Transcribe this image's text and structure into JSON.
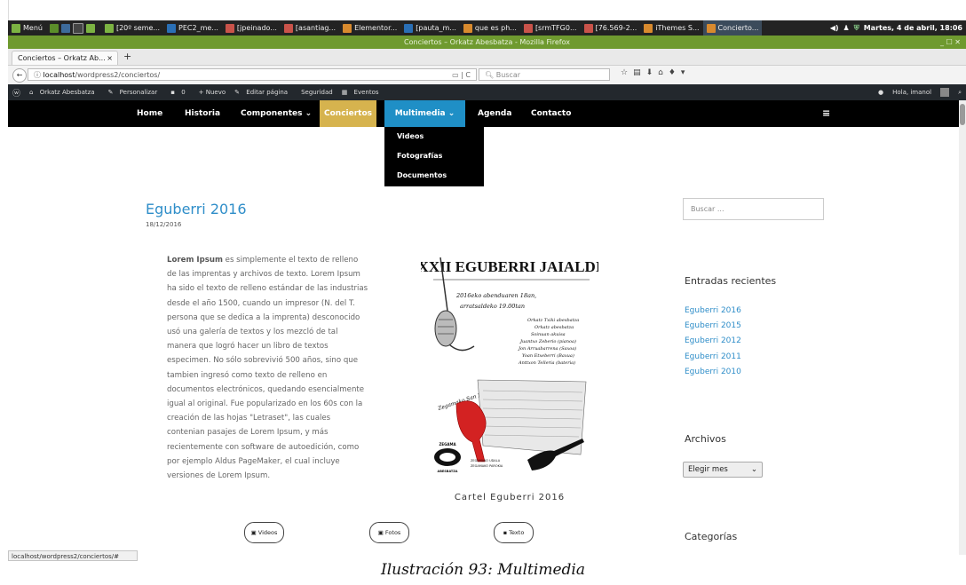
{
  "panel": {
    "menu_label": "Menú",
    "tasks": [
      "[20º seme...",
      "PEC2_me...",
      "[jpeinado...",
      "[asantiag...",
      "Elementor...",
      "[pauta_m...",
      "que es ph...",
      "[srmTFG0...",
      "[76.569-2...",
      "iThemes S...",
      "Concierto..."
    ],
    "clock": "Martes, 4 de abril, 18:06"
  },
  "window": {
    "title": "Conciertos – Orkatz Abesbatza - Mozilla Firefox",
    "tab_label": "Conciertos – Orkatz Ab...",
    "tab_close": "×",
    "new_tab": "+"
  },
  "navbar": {
    "back": "←",
    "url_host": "localhost",
    "url_path": "/wordpress2/conciertos/",
    "search_placeholder": "Buscar"
  },
  "admin_bar": {
    "site": "Orkatz Abesbatza",
    "customize": "Personalizar",
    "comments": "0",
    "new": "+ Nuevo",
    "edit": "Editar página",
    "security": "Seguridad",
    "events": "Eventos",
    "greeting": "Hola, imanol"
  },
  "nav": {
    "items": [
      "Home",
      "Historia",
      "Componentes",
      "Conciertos",
      "Multimedia",
      "Agenda",
      "Contacto"
    ],
    "menu_icon": "≡",
    "dropdown": [
      "Videos",
      "Fotografías",
      "Documentos"
    ]
  },
  "post": {
    "title": "Eguberri 2016",
    "date": "18/12/2016",
    "lead": "Lorem Ipsum",
    "body": " es simplemente el texto de relleno de las imprentas y archivos de texto. Lorem Ipsum ha sido el texto de relleno estándar de las industrias desde el año 1500, cuando un impresor (N. del T. persona que se dedica a la imprenta) desconocido usó una galería de textos y los mezcló de tal manera que logró hacer un libro de textos especimen. No sólo sobrevivió 500 años, sino que tambien ingresó como texto de relleno en documentos electrónicos, quedando esencialmente igual al original. Fue popularizado en los 60s con la creación de las hojas \"Letraset\", las cuales contenian pasajes de Lorem Ipsum, y más recientemente con software de autoedición, como por ejemplo Aldus PageMaker, el cual incluye versiones de Lorem Ipsum.",
    "caption": "Cartel Eguberri 2016",
    "buttons": [
      "Videos",
      "Fotos",
      "Texto"
    ]
  },
  "poster": {
    "heading": "XXXII EGUBERRI JAIALDIA",
    "line1": "2016eko abenduaren 18an,",
    "line2": "arratsaldeko 19.00tan",
    "performers": [
      "Orkatz Txiki abesbatza",
      "Orkatz abesbatza",
      "Soinuan akuisa",
      "Juantxo Zeberio (pianoa)",
      "Jon Arruabarrena (Saxoa)",
      "Yoan Etxeberri (Baxua)",
      "Anttxon Telleria (bateria)"
    ],
    "place": "Zegamako San Martin parrokian",
    "logo": "ZEGAMA",
    "logo_sub": "ABESBATZA",
    "sponsor1": "ZEGAMAKO UDALA",
    "sponsor2": "ZEGAMAKO PAROKIA"
  },
  "sidebar": {
    "search_placeholder": "Buscar ...",
    "recent_heading": "Entradas recientes",
    "recent": [
      "Eguberri 2016",
      "Eguberri 2015",
      "Eguberri 2012",
      "Eguberri 2011",
      "Eguberri 2010"
    ],
    "archives_heading": "Archivos",
    "archives_select": "Elegir mes",
    "categories_heading": "Categorías"
  },
  "status_url": "localhost/wordpress2/conciertos/#",
  "figure_caption": "Ilustración 93: Multimedia",
  "colors": {
    "accent_blue": "#2f8ec9",
    "current_menu": "#d6b34e",
    "hover_menu": "#1f8fc6",
    "title_bar": "#6f9a2f"
  }
}
